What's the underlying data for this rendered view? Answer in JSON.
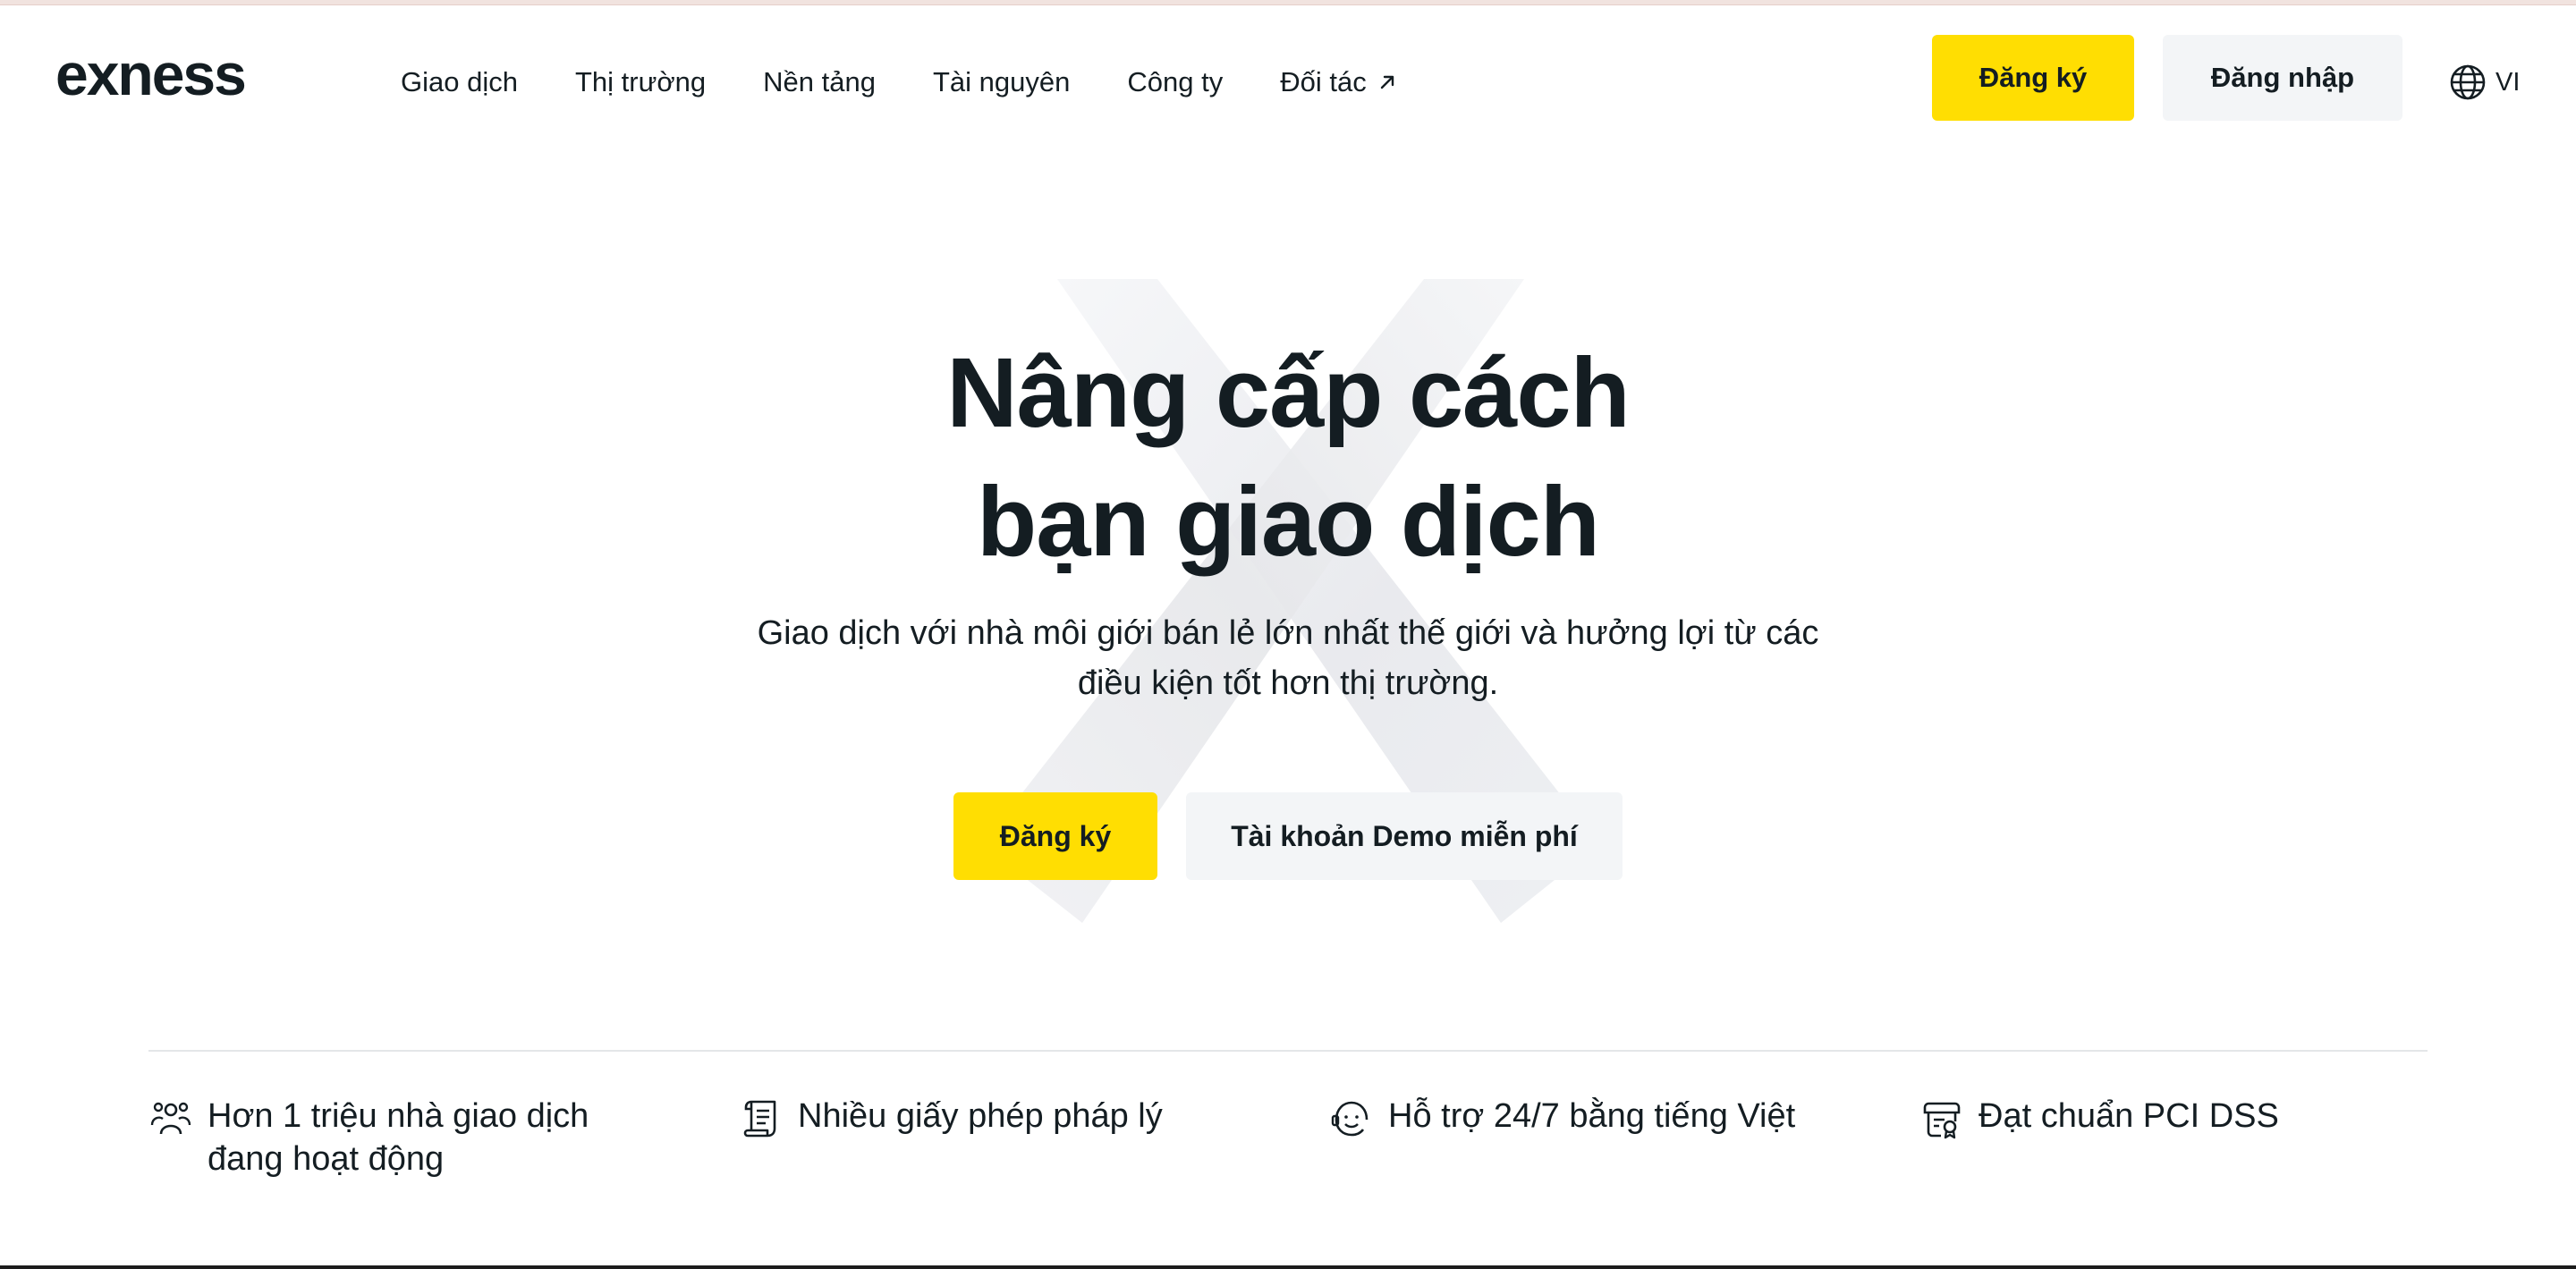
{
  "header": {
    "logo_text": "exness",
    "nav": [
      {
        "label": "Giao dịch"
      },
      {
        "label": "Thị trường"
      },
      {
        "label": "Nền tảng"
      },
      {
        "label": "Tài nguyên"
      },
      {
        "label": "Công ty"
      },
      {
        "label": "Đối tác",
        "icon": "external-arrow-icon"
      }
    ],
    "register_label": "Đăng ký",
    "login_label": "Đăng nhập",
    "language": "VI",
    "language_icon": "globe-icon"
  },
  "hero": {
    "title_line1": "Nâng cấp cách",
    "title_line2": "bạn giao dịch",
    "subtitle_line1": "Giao dịch với nhà môi giới bán lẻ lớn nhất thế giới và hưởng lợi từ các",
    "subtitle_line2": "điều kiện tốt hơn thị trường.",
    "register_label": "Đăng ký",
    "demo_label": "Tài khoản Demo miễn phí",
    "background_icon": "exness-x-mark"
  },
  "features": [
    {
      "icon": "users-icon",
      "line1": "Hơn 1 triệu nhà giao dịch",
      "line2": "đang hoạt động"
    },
    {
      "icon": "license-icon",
      "line1": "Nhiều giấy phép pháp lý"
    },
    {
      "icon": "support-icon",
      "line1": "Hỗ trợ 24/7 bằng tiếng Việt"
    },
    {
      "icon": "certificate-icon",
      "line1": "Đạt chuẩn PCI DSS"
    }
  ],
  "colors": {
    "accent_yellow": "#ffde02",
    "secondary_button": "#f3f5f7",
    "text": "#141d22",
    "divider": "#e4e6e8"
  }
}
